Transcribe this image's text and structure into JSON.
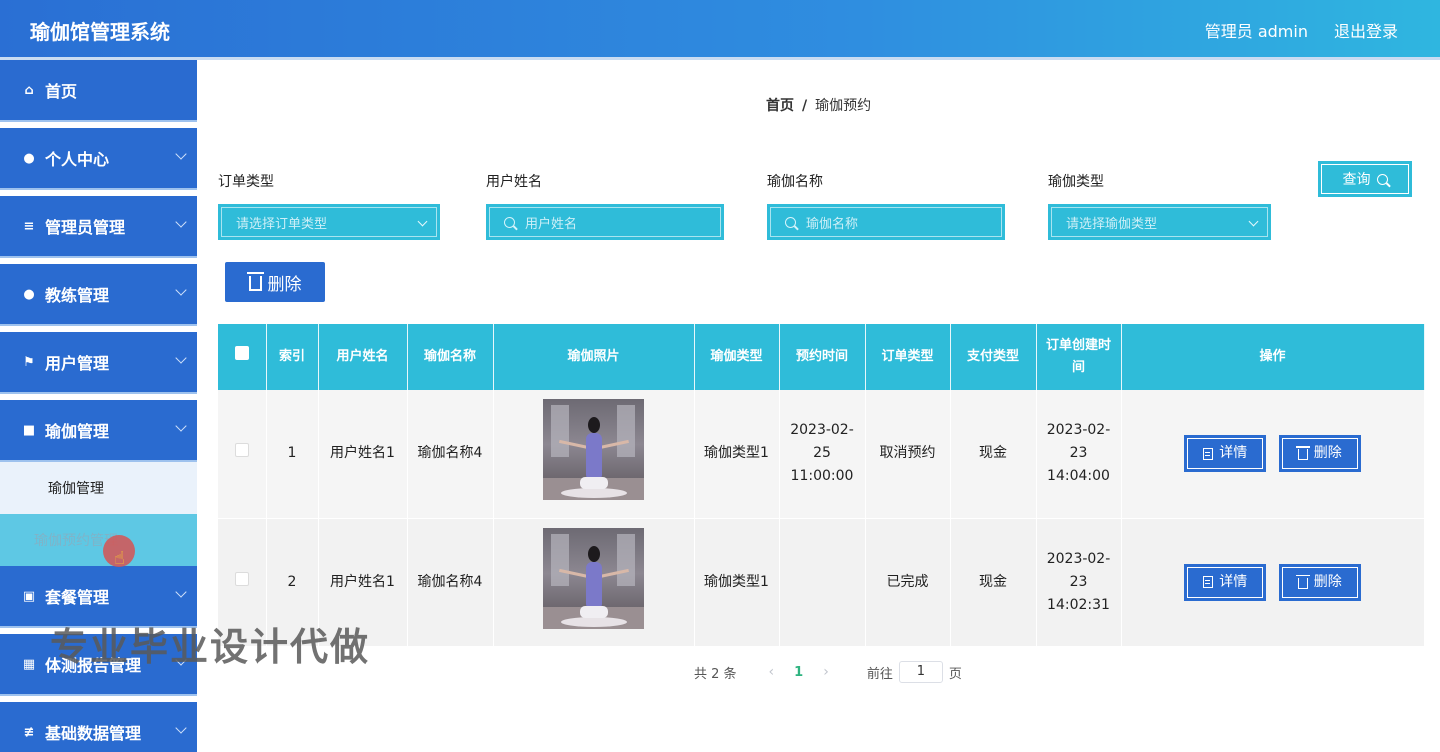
{
  "header": {
    "title": "瑜伽馆管理系统",
    "admin_label": "管理员 admin",
    "logout_label": "退出登录"
  },
  "sidebar": {
    "items": [
      {
        "label": "首页",
        "icon": "home-icon"
      },
      {
        "label": "个人中心",
        "icon": "user-icon"
      },
      {
        "label": "管理员管理",
        "icon": "list-icon"
      },
      {
        "label": "教练管理",
        "icon": "location-icon"
      },
      {
        "label": "用户管理",
        "icon": "flag-icon"
      },
      {
        "label": "瑜伽管理",
        "icon": "briefcase-icon"
      }
    ],
    "submenu": [
      {
        "label": "瑜伽管理"
      },
      {
        "label": "瑜伽预约管理"
      }
    ],
    "items_after": [
      {
        "label": "套餐管理",
        "icon": "clipboard-icon"
      },
      {
        "label": "体测报告管理",
        "icon": "grid-icon"
      },
      {
        "label": "基础数据管理",
        "icon": "sliders-icon"
      }
    ]
  },
  "breadcrumb": {
    "home": "首页",
    "separator": "/",
    "current": "瑜伽预约"
  },
  "filters": {
    "order_type": {
      "label": "订单类型",
      "placeholder": "请选择订单类型"
    },
    "user_name": {
      "label": "用户姓名",
      "placeholder": "用户姓名"
    },
    "yoga_name": {
      "label": "瑜伽名称",
      "placeholder": "瑜伽名称"
    },
    "yoga_type": {
      "label": "瑜伽类型",
      "placeholder": "请选择瑜伽类型"
    },
    "query_label": "查询"
  },
  "toolbar": {
    "delete_label": "删除"
  },
  "table": {
    "headers": [
      "索引",
      "用户姓名",
      "瑜伽名称",
      "瑜伽照片",
      "瑜伽类型",
      "预约时间",
      "订单类型",
      "支付类型",
      "订单创建时间",
      "操作"
    ],
    "rows": [
      {
        "index": "1",
        "user_name": "用户姓名1",
        "yoga_name": "瑜伽名称4",
        "yoga_type": "瑜伽类型1",
        "booking_time": "2023-02-25 11:00:00",
        "order_type": "取消预约",
        "payment_type": "现金",
        "created_time": "2023-02-23 14:04:00"
      },
      {
        "index": "2",
        "user_name": "用户姓名1",
        "yoga_name": "瑜伽名称4",
        "yoga_type": "瑜伽类型1",
        "booking_time": "",
        "order_type": "已完成",
        "payment_type": "现金",
        "created_time": "2023-02-23 14:02:31"
      }
    ],
    "detail_label": "详情",
    "delete_label": "删除"
  },
  "pagination": {
    "total_text": "共 2 条",
    "current_page": "1",
    "goto_label": "前往",
    "page_input": "1",
    "page_suffix": "页"
  },
  "watermark": "专业毕业设计代做"
}
